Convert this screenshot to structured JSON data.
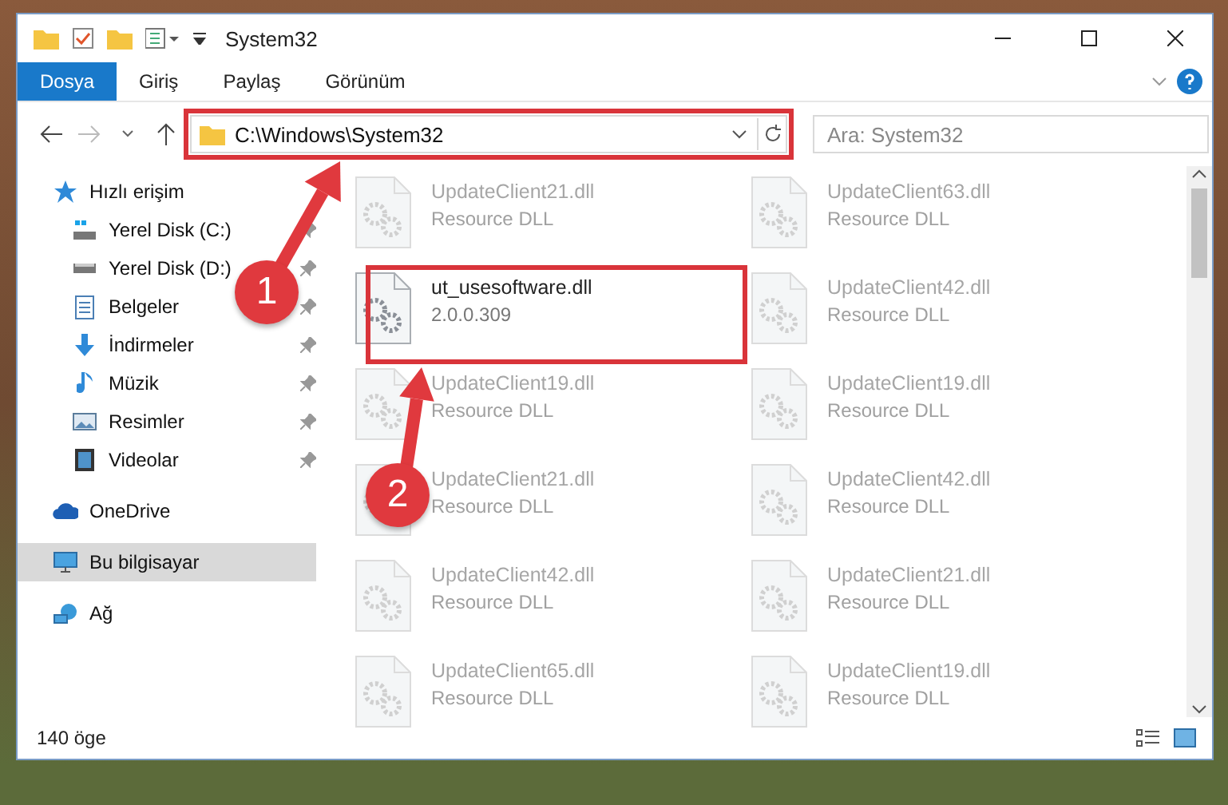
{
  "window": {
    "title": "System32"
  },
  "ribbon_tabs": [
    {
      "label": "Dosya",
      "selected": true
    },
    {
      "label": "Giriş",
      "selected": false
    },
    {
      "label": "Paylaş",
      "selected": false
    },
    {
      "label": "Görünüm",
      "selected": false
    }
  ],
  "address": {
    "path": "C:\\Windows\\System32"
  },
  "search": {
    "placeholder": "Ara: System32"
  },
  "nav": [
    {
      "label": "Hızlı erişim",
      "kind": "star",
      "selected": false,
      "children": [
        {
          "label": "Yerel Disk (C:)",
          "kind": "drive-c",
          "pinned": true
        },
        {
          "label": "Yerel Disk (D:)",
          "kind": "drive",
          "pinned": true
        },
        {
          "label": "Belgeler",
          "kind": "docs",
          "pinned": true
        },
        {
          "label": "İndirmeler",
          "kind": "download",
          "pinned": true
        },
        {
          "label": "Müzik",
          "kind": "music",
          "pinned": true
        },
        {
          "label": "Resimler",
          "kind": "pictures",
          "pinned": true
        },
        {
          "label": "Videolar",
          "kind": "video",
          "pinned": true
        }
      ]
    },
    {
      "label": "OneDrive",
      "kind": "cloud",
      "selected": false
    },
    {
      "label": "Bu bilgisayar",
      "kind": "pc",
      "selected": true
    },
    {
      "label": "Ağ",
      "kind": "network",
      "selected": false
    }
  ],
  "files": [
    {
      "name": "UpdateClient21.dll",
      "detail": "Resource DLL",
      "kind": "faded"
    },
    {
      "name": "UpdateClient63.dll",
      "detail": "Resource DLL",
      "kind": "faded"
    },
    {
      "name": "ut_usesoftware.dll",
      "detail": "2.0.0.309",
      "kind": "focus"
    },
    {
      "name": "UpdateClient42.dll",
      "detail": "Resource DLL",
      "kind": "faded"
    },
    {
      "name": "UpdateClient19.dll",
      "detail": "Resource DLL",
      "kind": "faded"
    },
    {
      "name": "UpdateClient19.dll",
      "detail": "Resource DLL",
      "kind": "faded"
    },
    {
      "name": "UpdateClient21.dll",
      "detail": "Resource DLL",
      "kind": "faded"
    },
    {
      "name": "UpdateClient42.dll",
      "detail": "Resource DLL",
      "kind": "faded"
    },
    {
      "name": "UpdateClient42.dll",
      "detail": "Resource DLL",
      "kind": "faded"
    },
    {
      "name": "UpdateClient21.dll",
      "detail": "Resource DLL",
      "kind": "faded"
    },
    {
      "name": "UpdateClient65.dll",
      "detail": "Resource DLL",
      "kind": "faded"
    },
    {
      "name": "UpdateClient19.dll",
      "detail": "Resource DLL",
      "kind": "faded"
    }
  ],
  "status_bar": {
    "count": "140 öge"
  },
  "annotations": [
    {
      "number": "1"
    },
    {
      "number": "2"
    }
  ]
}
